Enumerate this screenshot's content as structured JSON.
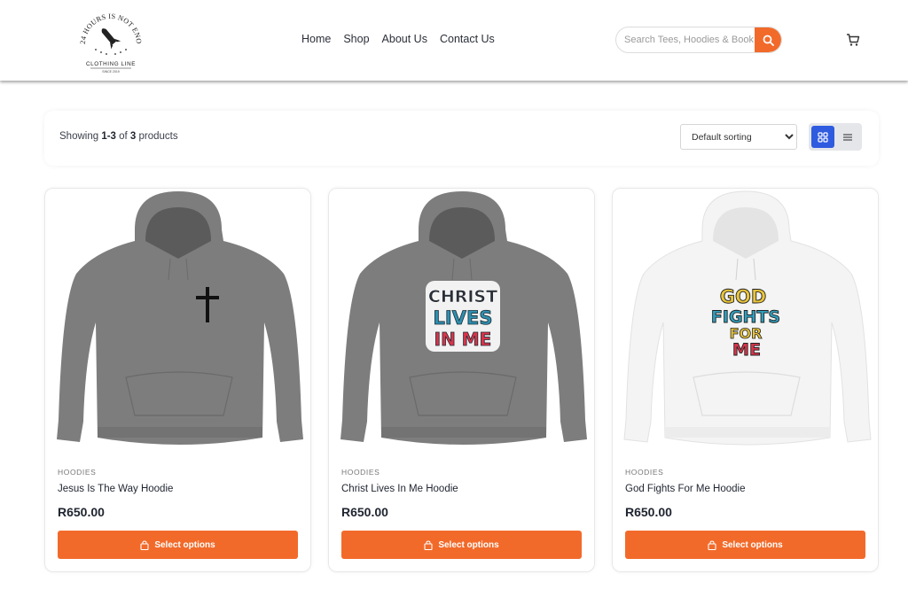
{
  "brand": {
    "logo_arc_text": "24 HOURS IS NOT ENOUGH",
    "logo_line": "CLOTHING LINE",
    "logo_since": "SINCE 2019"
  },
  "nav": {
    "items": [
      {
        "label": "Home"
      },
      {
        "label": "Shop"
      },
      {
        "label": "About Us"
      },
      {
        "label": "Contact Us"
      }
    ]
  },
  "search": {
    "placeholder": "Search Tees, Hoodies & Book",
    "icon": "search-icon"
  },
  "cart": {
    "icon": "cart-icon"
  },
  "toolbar": {
    "showing_prefix": "Showing ",
    "range": "1-3",
    "of_word": " of ",
    "total": "3",
    "suffix": " products",
    "sort_selected": "Default sorting",
    "view_grid_icon": "grid-view-icon",
    "view_list_icon": "list-view-icon"
  },
  "products": [
    {
      "category": "HOODIES",
      "title": "Jesus Is The Way Hoodie",
      "price": "R650.00",
      "button": "Select options",
      "hoodie_color": "#7d7d7d",
      "graphic": "cross"
    },
    {
      "category": "HOODIES",
      "title": "Christ Lives In Me Hoodie",
      "price": "R650.00",
      "button": "Select options",
      "hoodie_color": "#7d7d7d",
      "graphic": "christ-lives-in-me",
      "graphic_text": [
        "CHRIST",
        "LIVES",
        "IN ME"
      ]
    },
    {
      "category": "HOODIES",
      "title": "God Fights For Me Hoodie",
      "price": "R650.00",
      "button": "Select options",
      "hoodie_color": "#f4f4f4",
      "graphic": "god-fights-for-me",
      "graphic_text": [
        "GOD",
        "FIGHTS",
        "FOR",
        "ME"
      ]
    }
  ],
  "colors": {
    "accent": "#f26a2a",
    "grid_active": "#2f5be0"
  }
}
